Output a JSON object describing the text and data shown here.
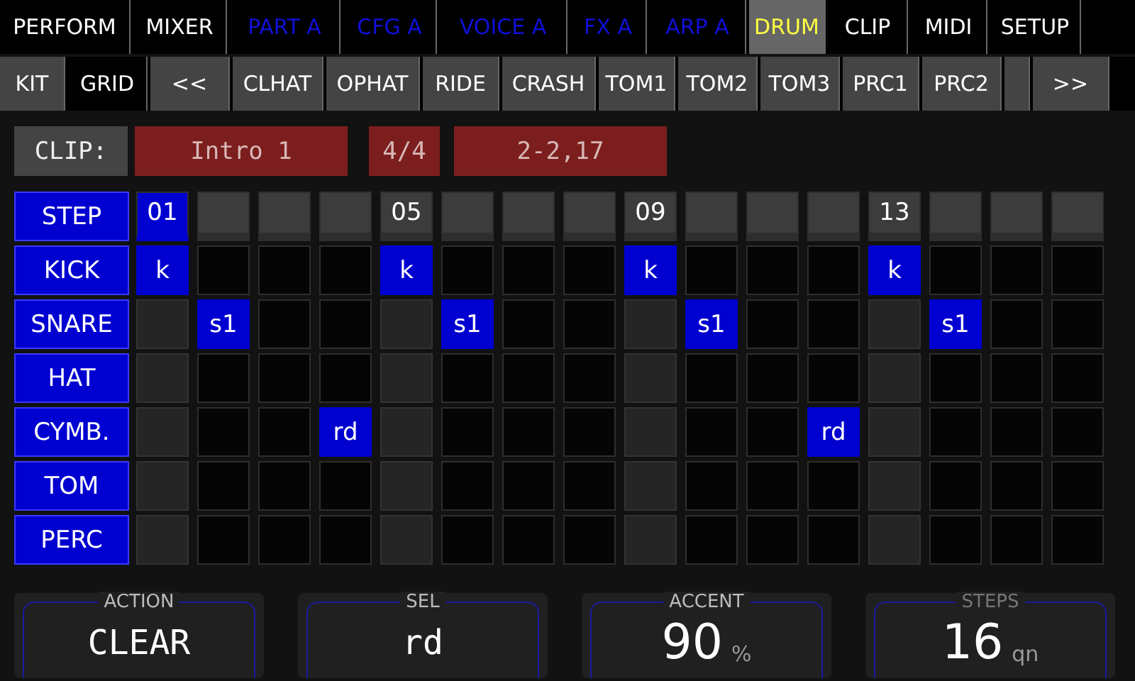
{
  "main_tabs": [
    {
      "label": "PERFORM",
      "kind": "global",
      "selected": false
    },
    {
      "label": "MIXER",
      "kind": "global",
      "selected": false
    },
    {
      "label": "PART A",
      "kind": "part",
      "selected": false
    },
    {
      "label": "CFG A",
      "kind": "part",
      "selected": false
    },
    {
      "label": "VOICE A",
      "kind": "part",
      "selected": false
    },
    {
      "label": "FX A",
      "kind": "part",
      "selected": false
    },
    {
      "label": "ARP A",
      "kind": "part",
      "selected": false
    },
    {
      "label": "DRUM",
      "kind": "global",
      "selected": true
    },
    {
      "label": "CLIP",
      "kind": "global",
      "selected": false
    },
    {
      "label": "MIDI",
      "kind": "global",
      "selected": false
    },
    {
      "label": "SETUP",
      "kind": "global",
      "selected": false
    }
  ],
  "sub_tabs": [
    {
      "label": "KIT",
      "selected": false
    },
    {
      "label": "GRID",
      "selected": true
    },
    {
      "label": "<<",
      "selected": false
    },
    {
      "label": "CLHAT",
      "selected": false
    },
    {
      "label": "OPHAT",
      "selected": false
    },
    {
      "label": "RIDE",
      "selected": false
    },
    {
      "label": "CRASH",
      "selected": false
    },
    {
      "label": "TOM1",
      "selected": false
    },
    {
      "label": "TOM2",
      "selected": false
    },
    {
      "label": "TOM3",
      "selected": false
    },
    {
      "label": "PRC1",
      "selected": false
    },
    {
      "label": "PRC2",
      "selected": false
    },
    {
      "selected": false
    },
    {
      "label": ">>",
      "selected": false
    }
  ],
  "clip": {
    "label": "CLIP:",
    "name": "Intro 1",
    "meter": "4/4",
    "position": "2-2,17"
  },
  "grid": {
    "header_label": "STEP",
    "steps": [
      {
        "label": "01",
        "selected": true
      },
      {
        "selected": false
      },
      {
        "selected": false
      },
      {
        "selected": false
      },
      {
        "label": "05",
        "selected": false
      },
      {
        "selected": false
      },
      {
        "selected": false
      },
      {
        "selected": false
      },
      {
        "label": "09",
        "selected": false
      },
      {
        "selected": false
      },
      {
        "selected": false
      },
      {
        "selected": false
      },
      {
        "label": "13",
        "selected": false
      },
      {
        "selected": false
      },
      {
        "selected": false
      },
      {
        "selected": false
      }
    ],
    "tracks": [
      {
        "name": "KICK",
        "cells": [
          "k",
          null,
          null,
          null,
          "k",
          null,
          null,
          null,
          "k",
          null,
          null,
          null,
          "k",
          null,
          null,
          null
        ]
      },
      {
        "name": "SNARE",
        "cells": [
          null,
          "s1",
          null,
          null,
          null,
          "s1",
          null,
          null,
          null,
          "s1",
          null,
          null,
          null,
          "s1",
          null,
          null
        ]
      },
      {
        "name": "HAT",
        "cells": [
          null,
          null,
          null,
          null,
          null,
          null,
          null,
          null,
          null,
          null,
          null,
          null,
          null,
          null,
          null,
          null
        ]
      },
      {
        "name": "CYMB.",
        "cells": [
          null,
          null,
          null,
          "rd",
          null,
          null,
          null,
          null,
          null,
          null,
          null,
          "rd",
          null,
          null,
          null,
          null
        ]
      },
      {
        "name": "TOM",
        "cells": [
          null,
          null,
          null,
          null,
          null,
          null,
          null,
          null,
          null,
          null,
          null,
          null,
          null,
          null,
          null,
          null
        ]
      },
      {
        "name": "PERC",
        "cells": [
          null,
          null,
          null,
          null,
          null,
          null,
          null,
          null,
          null,
          null,
          null,
          null,
          null,
          null,
          null,
          null
        ]
      }
    ]
  },
  "controls": [
    {
      "label": "ACTION",
      "value": "CLEAR",
      "disabled": false
    },
    {
      "label": "SEL",
      "value": "rd",
      "disabled": false
    },
    {
      "label": "ACCENT",
      "value": "90",
      "unit": "%",
      "disabled": false
    },
    {
      "label": "STEPS",
      "value": "16",
      "unit": "qn",
      "disabled": true
    }
  ]
}
